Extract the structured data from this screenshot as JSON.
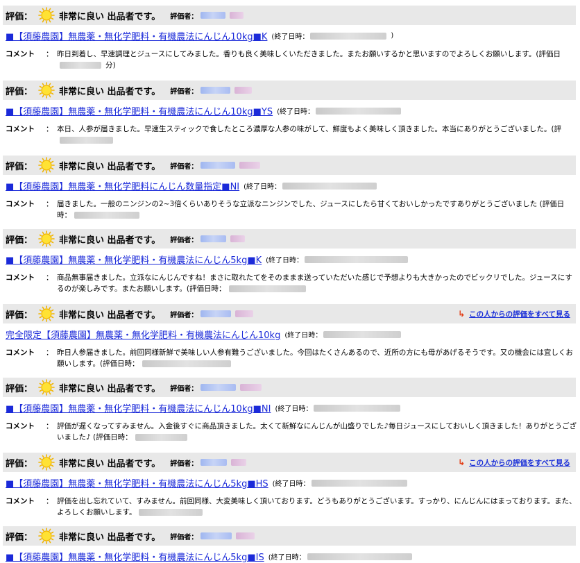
{
  "labels": {
    "rating": "評価：",
    "rater": "評価者：",
    "comment": "コメント",
    "colon": "：",
    "end_date": "(終了日時：",
    "see_all": "この人からの評価をすべて見る"
  },
  "entries": [
    {
      "rating_text": "非常に良い 出品者です。",
      "title": "■【須藤農園】無農薬・無化学肥料・有機農法にんじん10kg■K",
      "comment": "昨日到着し、早速調理とジュースにしてみました。香りも良く美味しくいただきました。またお願いするかと思いますのでよろしくお願いします。(評価日",
      "comment_tail": "分)",
      "see_all": false
    },
    {
      "rating_text": "非常に良い 出品者です。",
      "title": "■【須藤農園】無農薬・無化学肥料・有機農法にんじん10kg■YS",
      "comment": "本日、人参が届きました。早速生スティックで食したところ濃厚な人参の味がして、鮮度もよく美味しく頂きました。本当にありがとうございました。(評",
      "comment_tail": "",
      "see_all": false
    },
    {
      "rating_text": "非常に良い 出品者です。",
      "title": "■【須藤農園】無農薬・無化学肥料にんじん数量指定■NI",
      "comment": "届きました。一般のニンジンの2~3倍くらいありそうな立派なニンジンでした、ジュースにしたら甘くておいしかったですありがとうございました (評価日時：",
      "comment_tail": "",
      "see_all": false
    },
    {
      "rating_text": "非常に良い 出品者です。",
      "title": "■【須藤農園】無農薬・無化学肥料・有機農法にんじん5kg■K",
      "comment": "商品無事届きました。立派なにんじんですね！まさに取れたてをそのままま送っていただいた感じで予想よりも大きかったのでビックリでした。ジュースにするのが楽しみです。またお願いします。(評価日時：",
      "comment_tail": "",
      "see_all": false
    },
    {
      "rating_text": "非常に良い 出品者です。",
      "title": "完全限定【須藤農園】無農薬・無化学肥料・有機農法にんじん10kg",
      "comment": "昨日人参届きました。前回同様新鮮で美味しい人参有難うございました。今回はたくさんあるので、近所の方にも母があげるそうです。又の機会には宜しくお願いします。(評価日時：",
      "comment_tail": "",
      "see_all": true
    },
    {
      "rating_text": "非常に良い 出品者です。",
      "title": "■【須藤農園】無農薬・無化学肥料・有機農法にんじん10kg■NI",
      "comment": "評価が遅くなってすみません。入金後すぐに商品頂きました。太くて新鮮なにんじんが山盛りでした♪毎日ジュースにしておいしく頂きました！ありがとうございました♪ (評価日時：",
      "comment_tail": "",
      "see_all": false
    },
    {
      "rating_text": "非常に良い 出品者です。",
      "title": "■【須藤農園】無農薬・無化学肥料・有機農法にんじん5kg■HS",
      "comment": "評価を出し忘れていて、すみません。前回同様、大変美味しく頂いております。どうもありがとうございます。すっかり、にんじんにはまっております。また、よろしくお願いします。",
      "comment_tail": "",
      "see_all": true
    },
    {
      "rating_text": "非常に良い 出品者です。",
      "title": "■【須藤農園】無農薬・無化学肥料・有機農法にんじん5kg■IS",
      "comment": "",
      "comment_tail": "",
      "see_all": false
    }
  ]
}
